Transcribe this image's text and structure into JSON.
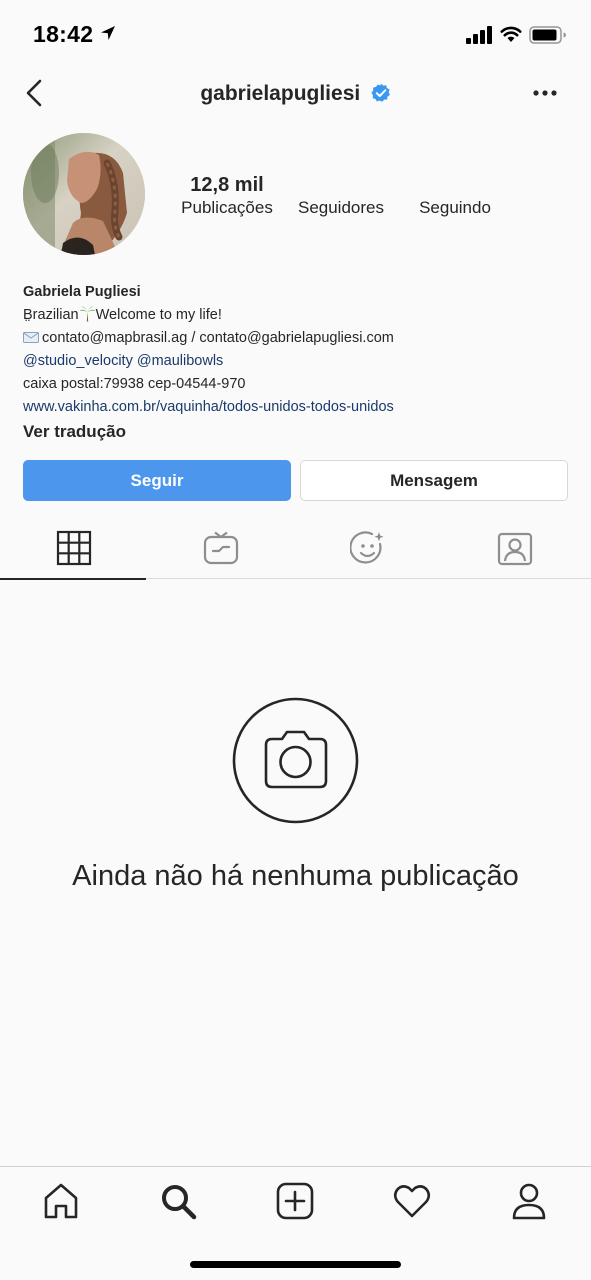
{
  "status_bar": {
    "time": "18:42",
    "icons": [
      "location-arrow-icon",
      "cellular-signal-icon",
      "wifi-icon",
      "battery-icon"
    ]
  },
  "nav": {
    "username": "gabrielapugliesi",
    "verified": true,
    "icons": [
      "chevron-left-icon",
      "verified-badge-icon",
      "more-horizontal-icon"
    ]
  },
  "profile": {
    "avatar_icon": "profile-photo",
    "stats": {
      "posts_count": "12,8 mil",
      "posts_label": "Publicações",
      "followers_count": "",
      "followers_label": "Seguidores",
      "following_count": "",
      "following_label": "Seguindo"
    },
    "bio": {
      "name": "Gabriela Pugliesi",
      "line1_text_a": "B̤razilian",
      "line1_text_b": "Welcome to my life!",
      "line2": "contato@mapbrasil.ag / contato@gabrielapugliesi.com",
      "line3": "@studio_velocity @maulibowls",
      "line4": "caixa postal:79938 cep-04544-970",
      "line5": "www.vakinha.com.br/vaquinha/todos-unidos-todos-unidos",
      "translate": "Ver tradução"
    }
  },
  "actions": {
    "follow_label": "Seguir",
    "message_label": "Mensagem"
  },
  "tabs": [
    {
      "icon": "grid-icon",
      "active": true
    },
    {
      "icon": "igtv-icon",
      "active": false
    },
    {
      "icon": "effects-icon",
      "active": false
    },
    {
      "icon": "tagged-icon",
      "active": false
    }
  ],
  "empty_state": {
    "icon": "camera-icon",
    "text": "Ainda não há nenhuma publicação"
  },
  "bottom_nav": {
    "items": [
      "home-icon",
      "search-icon",
      "new-post-icon",
      "activity-heart-icon",
      "profile-icon"
    ]
  },
  "colors": {
    "follow_button": "#4c96ee",
    "verified_badge": "#3897f0",
    "link": "#1b3a6b",
    "text": "#262626",
    "background": "#fafafa"
  }
}
